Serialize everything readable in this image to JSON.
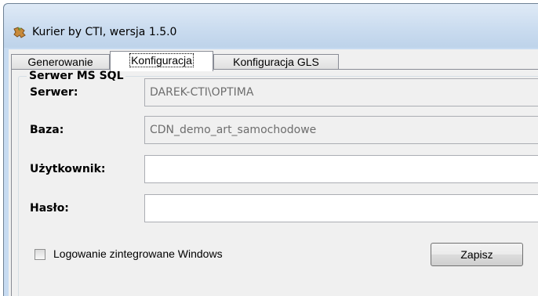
{
  "window": {
    "title": "Kurier by CTI, wersja 1.5.0",
    "icon": "puzzle-icon"
  },
  "tabs": [
    {
      "label": "Generowanie",
      "active": false
    },
    {
      "label": "Konfiguracja",
      "active": true
    },
    {
      "label": "Konfiguracja GLS",
      "active": false
    }
  ],
  "group": {
    "title": "Serwer MS SQL"
  },
  "fields": {
    "server": {
      "label": "Serwer:",
      "value": "DAREK-CTI\\OPTIMA"
    },
    "database": {
      "label": "Baza:",
      "value": "CDN_demo_art_samochodowe"
    },
    "user": {
      "label": "Użytkownik:",
      "value": ""
    },
    "password": {
      "label": "Hasło:",
      "value": ""
    }
  },
  "windows_auth": {
    "label": "Logowanie zintegrowane Windows",
    "checked": false
  },
  "save_button": {
    "label": "Zapisz"
  },
  "colors": {
    "titlebar": "#c9dbef",
    "client": "#f0f0f0",
    "readonly_text": "#6d6d6d"
  }
}
